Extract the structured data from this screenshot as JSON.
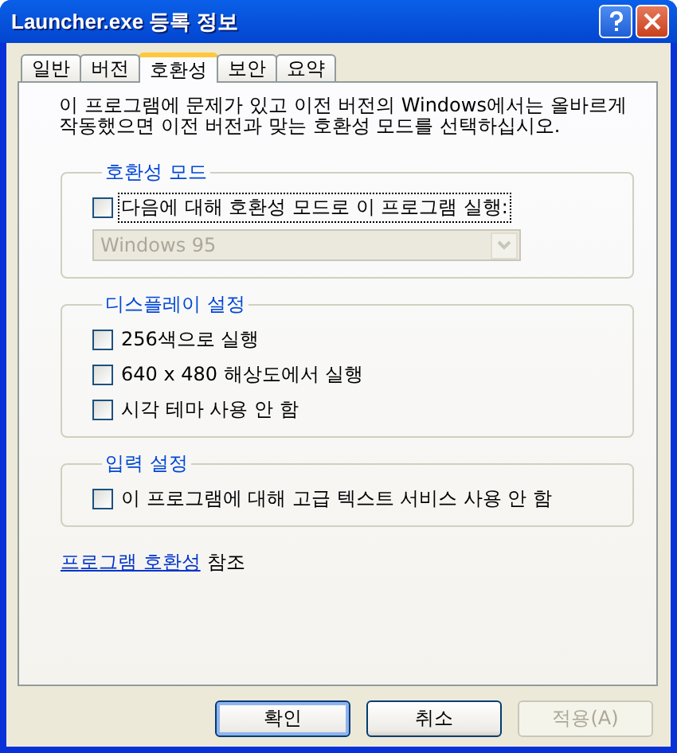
{
  "window": {
    "title": "Launcher.exe 등록 정보"
  },
  "tabs": [
    {
      "label": "일반",
      "selected": false
    },
    {
      "label": "버전",
      "selected": false
    },
    {
      "label": "호환성",
      "selected": true
    },
    {
      "label": "보안",
      "selected": false
    },
    {
      "label": "요약",
      "selected": false
    }
  ],
  "description": "이 프로그램에 문제가 있고 이전 버전의 Windows에서는 올바르게 작동했으면 이전 버전과 맞는 호환성 모드를 선택하십시오.",
  "groups": [
    {
      "legend": "호환성 모드",
      "items": [
        {
          "label": "다음에 대해 호환성 모드로 이 프로그램 실행:",
          "checked": false,
          "focused": true
        }
      ],
      "dropdown": {
        "value": "Windows 95",
        "disabled": true
      }
    },
    {
      "legend": "디스플레이 설정",
      "items": [
        {
          "label": "256색으로 실행",
          "checked": false,
          "focused": false
        },
        {
          "label": "640 x 480 해상도에서 실행",
          "checked": false,
          "focused": false
        },
        {
          "label": "시각 테마 사용 안 함",
          "checked": false,
          "focused": false
        }
      ]
    },
    {
      "legend": "입력 설정",
      "items": [
        {
          "label": "이 프로그램에 대해 고급 텍스트 서비스 사용 안 함",
          "checked": false,
          "focused": false
        }
      ]
    }
  ],
  "link": {
    "label": "프로그램 호환성",
    "suffix": "참조"
  },
  "buttons": [
    {
      "label": "확인",
      "disabled": false,
      "default": true
    },
    {
      "label": "취소",
      "disabled": false,
      "default": false
    },
    {
      "label": "적용(A)",
      "disabled": true,
      "default": false
    }
  ]
}
